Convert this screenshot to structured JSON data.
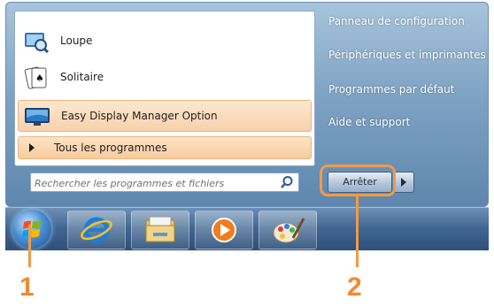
{
  "start_menu": {
    "programs": [
      {
        "label": "Loupe",
        "icon": "magnifier-icon"
      },
      {
        "label": "Solitaire",
        "icon": "solitaire-cards-icon"
      },
      {
        "label": "Easy Display Manager Option",
        "icon": "display-manager-icon"
      }
    ],
    "all_programs_label": "Tous les programmes",
    "search": {
      "placeholder": "Rechercher les programmes et fichiers",
      "value": ""
    },
    "right_links": [
      "Panneau de configuration",
      "Périphériques et imprimantes",
      "Programmes par défaut",
      "Aide et support"
    ],
    "shutdown_label": "Arrêter"
  },
  "taskbar": {
    "items": [
      "start-orb",
      "internet-explorer-icon",
      "windows-explorer-icon",
      "media-player-icon",
      "paint-icon"
    ]
  },
  "annotations": {
    "callout_1": "1",
    "callout_2": "2",
    "accent_color": "#f29a45"
  }
}
